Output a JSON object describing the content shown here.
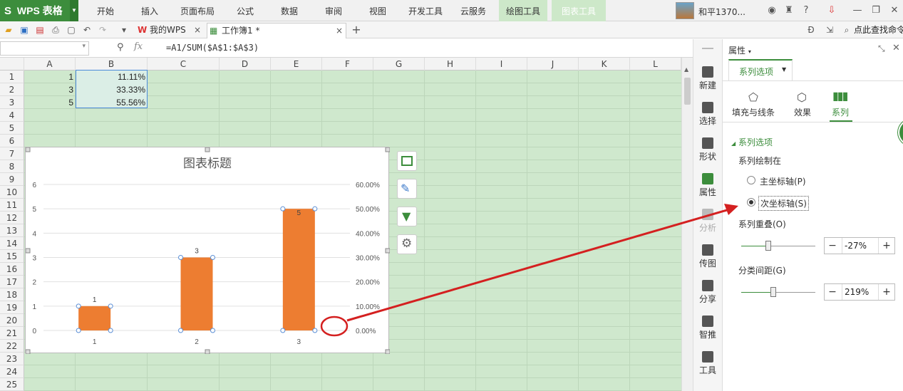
{
  "app": {
    "name": "WPS 表格"
  },
  "menu": [
    "开始",
    "插入",
    "页面布局",
    "公式",
    "数据",
    "审阅",
    "视图",
    "开发工具",
    "云服务",
    "绘图工具",
    "图表工具"
  ],
  "user": {
    "name": "和平1370..."
  },
  "tabs": [
    {
      "label": "我的WPS"
    },
    {
      "label": "工作簿1 *"
    }
  ],
  "search": {
    "placeholder": "点此查找命令"
  },
  "formula": {
    "text": "=A1/SUM($A$1:$A$3)"
  },
  "columns": [
    "A",
    "B",
    "C",
    "D",
    "E",
    "F",
    "G",
    "H",
    "I",
    "J",
    "K",
    "L"
  ],
  "rows": [
    "1",
    "2",
    "3",
    "4",
    "5",
    "6",
    "7",
    "8",
    "9",
    "10",
    "11",
    "12",
    "13",
    "14",
    "15",
    "16",
    "17",
    "18",
    "19",
    "20",
    "21",
    "22",
    "23",
    "24",
    "25"
  ],
  "cells": {
    "A1": "1",
    "B1": "11.11%",
    "A2": "3",
    "B2": "33.33%",
    "A3": "5",
    "B3": "55.56%"
  },
  "chart_data": {
    "type": "bar",
    "title": "图表标题",
    "categories": [
      "1",
      "2",
      "3"
    ],
    "series": [
      {
        "values": [
          1,
          3,
          5
        ],
        "color": "#ED7D31"
      }
    ],
    "data_labels": [
      "1",
      "3",
      "5"
    ],
    "ylim": [
      0,
      6
    ],
    "yticks": [
      "0",
      "1",
      "2",
      "3",
      "4",
      "5",
      "6"
    ],
    "y2lim": [
      0,
      0.6
    ],
    "y2ticks": [
      "0.00%",
      "10.00%",
      "20.00%",
      "30.00%",
      "40.00%",
      "50.00%",
      "60.00%"
    ],
    "xlabel": "",
    "ylabel": "",
    "grid": true,
    "legend": "none"
  },
  "rail": [
    "新建",
    "选择",
    "形状",
    "属性",
    "分析",
    "传图",
    "分享",
    "智推",
    "工具"
  ],
  "panel": {
    "title": "属性",
    "dropdown": "系列选项",
    "tabs": [
      "填充与线条",
      "效果",
      "系列"
    ],
    "section": "系列选项",
    "plot_on_label": "系列绘制在",
    "primary_axis": "主坐标轴(P)",
    "secondary_axis": "次坐标轴(S)",
    "overlap_label": "系列重叠(O)",
    "overlap_value": "-27%",
    "gap_label": "分类间距(G)",
    "gap_value": "219%"
  },
  "colors": {
    "accent": "#3c8d3c",
    "bar": "#ED7D31",
    "annotation": "#d42020"
  }
}
